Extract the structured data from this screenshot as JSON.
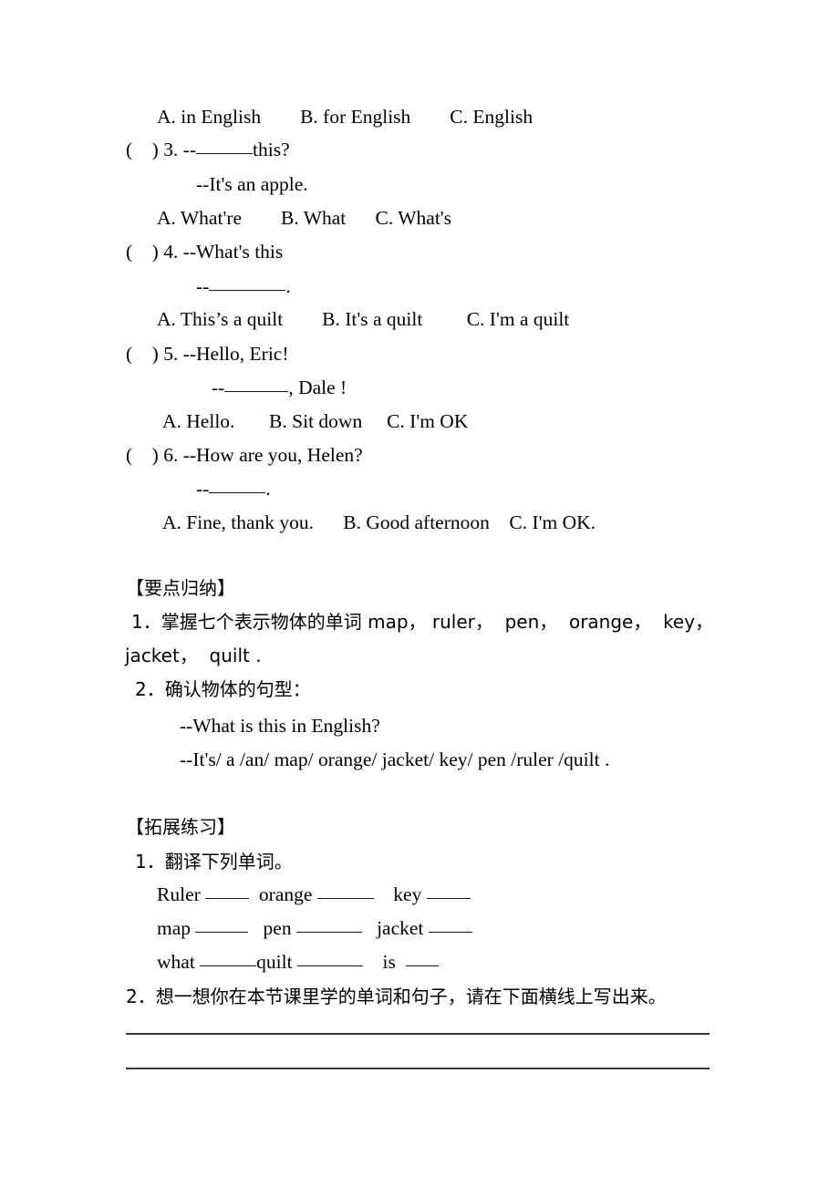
{
  "document": {
    "language": "zh-CN + en",
    "background_color": "#ffffff",
    "text_color": "#000000"
  },
  "quiz": {
    "q2_options": "A. in English        B. for English        C. English",
    "items": [
      {
        "marker": "(    ) 3. --",
        "stem_tail": "this?",
        "blank_width": 62,
        "reply": "--It's an apple.",
        "options": "A. What're        B. What      C. What's"
      },
      {
        "marker": "(    ) 4. --What's this",
        "reply_prefix": "--",
        "reply_blank_width": 84,
        "reply_suffix": ".",
        "options": "A. This’s a quilt        B. It's a quilt         C. I'm a quilt"
      },
      {
        "marker": "(    ) 5. --Hello, Eric!",
        "reply_prefix": "--",
        "reply_blank_width": 70,
        "reply_suffix": ", Dale !",
        "options": "A. Hello.       B. Sit down     C. I'm OK"
      },
      {
        "marker": "(    ) 6. --How are you, Helen?",
        "reply_prefix": "--",
        "reply_blank_width": 62,
        "reply_suffix": ".",
        "options": "A. Fine, thank you.      B. Good afternoon    C. I'm OK."
      }
    ]
  },
  "key_points": {
    "heading": "【要点归纳】",
    "item1_line1": "1．掌握七个表示物体的单词 map， ruler，  pen，  orange，  key，",
    "item1_line2": "jacket，  quilt .",
    "item2": "2．确认物体的句型：",
    "pattern_question": "--What is this in English?",
    "pattern_answer": "--It's/ a /an/ map/ orange/ jacket/ key/ pen /ruler /quilt ."
  },
  "extended_practice": {
    "heading": "【拓展练习】",
    "task1": "1．翻译下列单词。",
    "words_rows": [
      {
        "w1": "Ruler",
        "b1": 48,
        "w2": "orange",
        "b2": 62,
        "w3": "key",
        "b3": 48
      },
      {
        "w1": "map",
        "b1": 58,
        "w2": "pen",
        "b2": 72,
        "w3": "jacket",
        "b3": 48
      },
      {
        "w1": "what",
        "b1": 62,
        "w2": "quilt",
        "b2": 72,
        "w3": "is",
        "b3": 36
      }
    ],
    "task2": "2．想一想你在本节课里学的单词和句子，请在下面横线上写出来。",
    "answer_lines": [
      "",
      ""
    ]
  }
}
